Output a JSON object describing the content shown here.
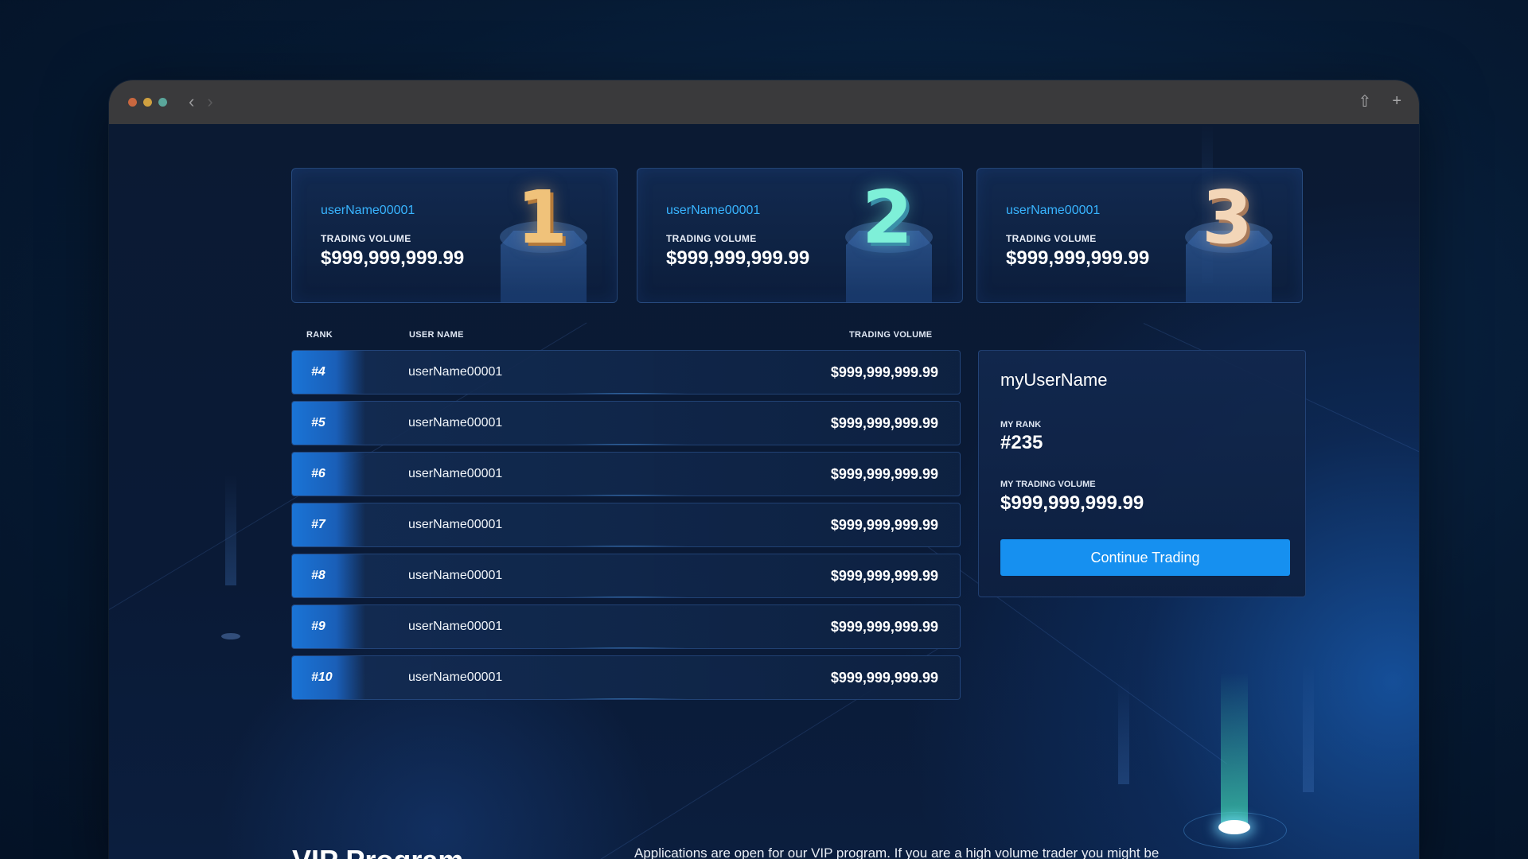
{
  "window": {
    "nav": {
      "back_icon": "‹",
      "forward_icon": "›"
    },
    "toolbar": {
      "share_icon": "⇧",
      "new_tab_icon": "+"
    }
  },
  "podium": [
    {
      "rank_numeral": "1",
      "username": "userName00001",
      "label": "TRADING VOLUME",
      "volume": "$999,999,999.99",
      "accent": "#f0c27a"
    },
    {
      "rank_numeral": "2",
      "username": "userName00001",
      "label": "TRADING VOLUME",
      "volume": "$999,999,999.99",
      "accent": "#7ef0d8"
    },
    {
      "rank_numeral": "3",
      "username": "userName00001",
      "label": "TRADING VOLUME",
      "volume": "$999,999,999.99",
      "accent": "#f3d6b8"
    }
  ],
  "table": {
    "headers": {
      "rank": "RANK",
      "user": "USER NAME",
      "volume": "TRADING VOLUME"
    },
    "rows": [
      {
        "rank": "#4",
        "user": "userName00001",
        "volume": "$999,999,999.99"
      },
      {
        "rank": "#5",
        "user": "userName00001",
        "volume": "$999,999,999.99"
      },
      {
        "rank": "#6",
        "user": "userName00001",
        "volume": "$999,999,999.99"
      },
      {
        "rank": "#7",
        "user": "userName00001",
        "volume": "$999,999,999.99"
      },
      {
        "rank": "#8",
        "user": "userName00001",
        "volume": "$999,999,999.99"
      },
      {
        "rank": "#9",
        "user": "userName00001",
        "volume": "$999,999,999.99"
      },
      {
        "rank": "#10",
        "user": "userName00001",
        "volume": "$999,999,999.99"
      }
    ]
  },
  "my_stats": {
    "username": "myUserName",
    "rank_label": "MY RANK",
    "rank": "#235",
    "volume_label": "MY TRADING VOLUME",
    "volume": "$999,999,999.99",
    "cta": "Continue Trading"
  },
  "vip": {
    "title": "VIP Program",
    "text": "Applications are open for our VIP program. If you are a high volume trader you might be"
  },
  "colors": {
    "accent_blue": "#1690f0",
    "username_blue": "#38b4ff",
    "background": "#0a1830"
  }
}
